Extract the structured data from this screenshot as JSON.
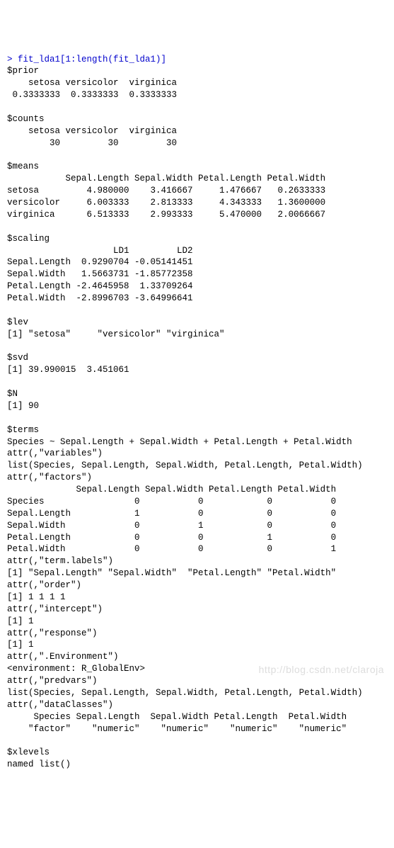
{
  "command": "> fit_lda1[1:length(fit_lda1)]",
  "prior": {
    "header": "$prior",
    "cols": "    setosa versicolor  virginica",
    "vals": " 0.3333333  0.3333333  0.3333333"
  },
  "counts": {
    "header": "$counts",
    "cols": "    setosa versicolor  virginica",
    "vals": "        30         30         30"
  },
  "means": {
    "header": "$means",
    "cols": "           Sepal.Length Sepal.Width Petal.Length Petal.Width",
    "r1": "setosa         4.980000    3.416667     1.476667   0.2633333",
    "r2": "versicolor     6.003333    2.813333     4.343333   1.3600000",
    "r3": "virginica      6.513333    2.993333     5.470000   2.0066667"
  },
  "scaling": {
    "header": "$scaling",
    "cols": "                    LD1         LD2",
    "r1": "Sepal.Length  0.9290704 -0.05141451",
    "r2": "Sepal.Width   1.5663731 -1.85772358",
    "r3": "Petal.Length -2.4645958  1.33709264",
    "r4": "Petal.Width  -2.8996703 -3.64996641"
  },
  "lev": {
    "header": "$lev",
    "vals": "[1] \"setosa\"     \"versicolor\" \"virginica\""
  },
  "svd": {
    "header": "$svd",
    "vals": "[1] 39.990015  3.451061"
  },
  "N": {
    "header": "$N",
    "vals": "[1] 90"
  },
  "terms": {
    "header": "$terms",
    "formula": "Species ~ Sepal.Length + Sepal.Width + Petal.Length + Petal.Width",
    "attr_variables": "attr(,\"variables\")",
    "variables_list": "list(Species, Sepal.Length, Sepal.Width, Petal.Length, Petal.Width)",
    "attr_factors": "attr(,\"factors\")",
    "factors_cols": "             Sepal.Length Sepal.Width Petal.Length Petal.Width",
    "factors_r1": "Species                 0           0            0           0",
    "factors_r2": "Sepal.Length            1           0            0           0",
    "factors_r3": "Sepal.Width             0           1            0           0",
    "factors_r4": "Petal.Length            0           0            1           0",
    "factors_r5": "Petal.Width             0           0            0           1",
    "attr_termlabels": "attr(,\"term.labels\")",
    "termlabels_vals": "[1] \"Sepal.Length\" \"Sepal.Width\"  \"Petal.Length\" \"Petal.Width\"",
    "attr_order": "attr(,\"order\")",
    "order_vals": "[1] 1 1 1 1",
    "attr_intercept": "attr(,\"intercept\")",
    "intercept_vals": "[1] 1",
    "attr_response": "attr(,\"response\")",
    "response_vals": "[1] 1",
    "attr_env": "attr(,\".Environment\")",
    "env_vals": "<environment: R_GlobalEnv>",
    "attr_predvars": "attr(,\"predvars\")",
    "predvars_list": "list(Species, Sepal.Length, Sepal.Width, Petal.Length, Petal.Width)",
    "attr_dataclasses": "attr(,\"dataClasses\")",
    "dataclasses_cols": "     Species Sepal.Length  Sepal.Width Petal.Length  Petal.Width",
    "dataclasses_vals": "    \"factor\"    \"numeric\"    \"numeric\"    \"numeric\"    \"numeric\""
  },
  "xlevels": {
    "header": "$xlevels",
    "vals": "named list()"
  },
  "watermark": "http://blog.csdn.net/claroja"
}
